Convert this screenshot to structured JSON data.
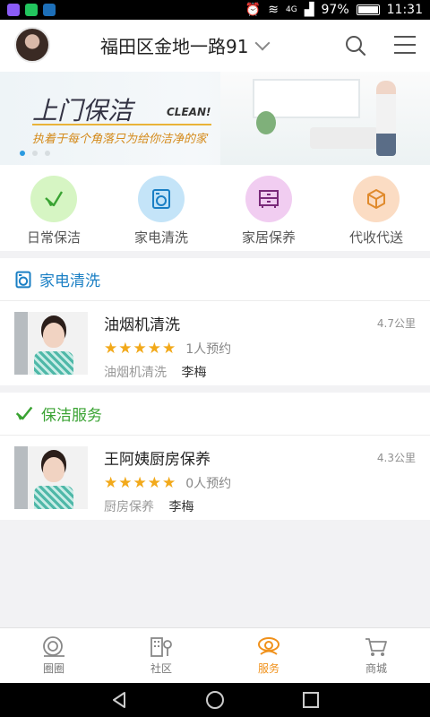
{
  "status_bar": {
    "battery": "97%",
    "time": "11:31",
    "network": "4G"
  },
  "header": {
    "location": "福田区金地一路91"
  },
  "banner": {
    "title": "上门保洁",
    "title_en": "CLEAN!",
    "subtitle": "执着于每个角落只为给你洁净的家"
  },
  "categories": [
    {
      "label": "日常保洁",
      "icon": "broom-icon",
      "color": "#d6f5c3"
    },
    {
      "label": "家电清洗",
      "icon": "washer-icon",
      "color": "#c4e4f8"
    },
    {
      "label": "家居保养",
      "icon": "cabinet-icon",
      "color": "#f1cdf1"
    },
    {
      "label": "代收代送",
      "icon": "package-icon",
      "color": "#fbdcc3"
    }
  ],
  "sections": [
    {
      "title": "家电清洗",
      "icon": "washer-icon",
      "items": [
        {
          "name": "油烟机清洗",
          "distance": "4.7公里",
          "reservations": "1人预约",
          "category": "油烟机清洗",
          "worker": "李梅",
          "rating": 5
        }
      ]
    },
    {
      "title": "保洁服务",
      "icon": "broom-icon",
      "items": [
        {
          "name": "王阿姨厨房保养",
          "distance": "4.3公里",
          "reservations": "0人预约",
          "category": "厨房保养",
          "worker": "李梅",
          "rating": 5
        }
      ]
    }
  ],
  "tabbar": [
    {
      "label": "圈圈",
      "icon": "circle-icon",
      "active": false
    },
    {
      "label": "社区",
      "icon": "community-icon",
      "active": false
    },
    {
      "label": "服务",
      "icon": "service-icon",
      "active": true
    },
    {
      "label": "商城",
      "icon": "cart-icon",
      "active": false
    }
  ],
  "colors": {
    "section_blue": "#1a7fc4",
    "section_green": "#3aa333",
    "accent_orange": "#f0911b",
    "star": "#f2a91a"
  }
}
